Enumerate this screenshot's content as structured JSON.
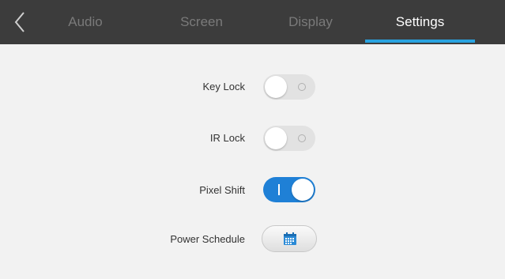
{
  "header": {
    "back_icon": "chevron-left-icon",
    "tabs": [
      {
        "label": "Audio",
        "active": false
      },
      {
        "label": "Screen",
        "active": false
      },
      {
        "label": "Display",
        "active": false
      },
      {
        "label": "Settings",
        "active": true
      }
    ]
  },
  "settings": {
    "key_lock": {
      "label": "Key Lock",
      "state": "off"
    },
    "ir_lock": {
      "label": "IR Lock",
      "state": "off"
    },
    "pixel_shift": {
      "label": "Pixel Shift",
      "state": "on"
    },
    "power_schedule": {
      "label": "Power Schedule",
      "icon": "calendar-icon"
    }
  },
  "colors": {
    "header_bg": "#3c3c3c",
    "active_tab_underline": "#29a3e0",
    "toggle_on": "#1f80d6",
    "toggle_off": "#e2e2e2",
    "background": "#f2f2f2"
  }
}
